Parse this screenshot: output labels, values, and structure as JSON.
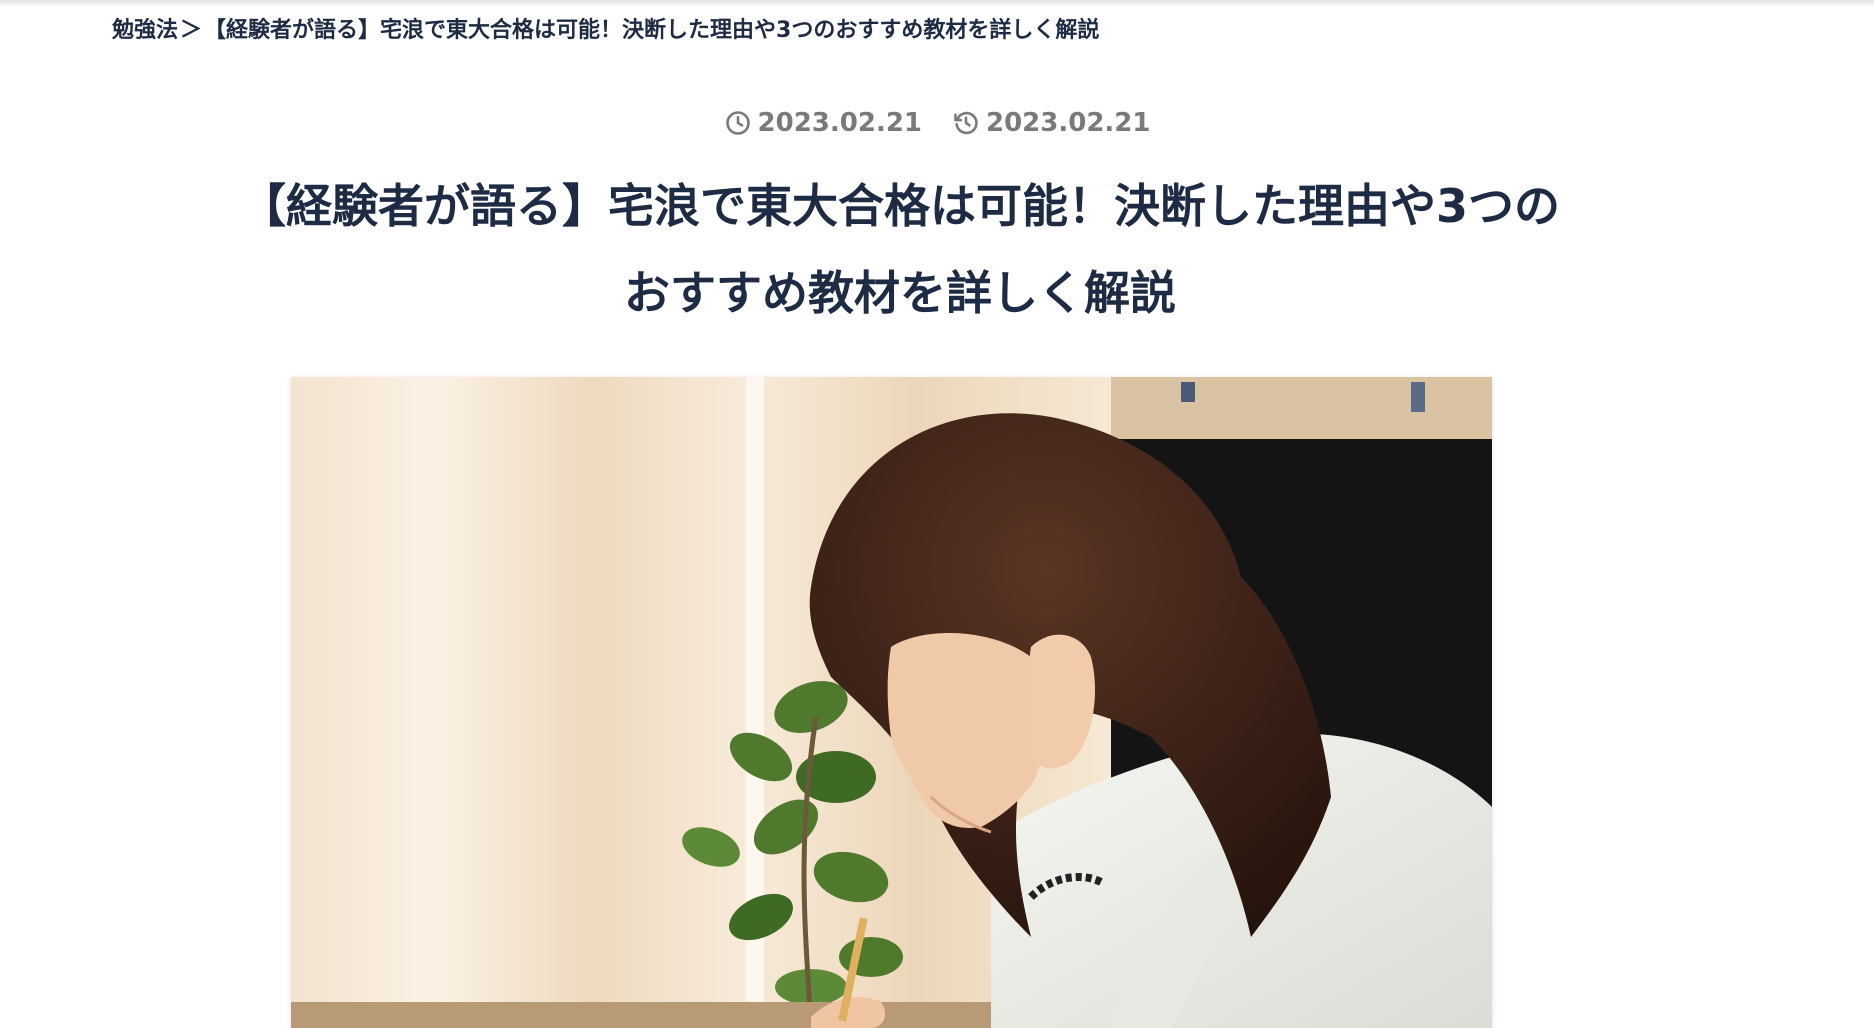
{
  "breadcrumb": {
    "parent": "勉強法",
    "separator": "＞",
    "current": "【経験者が語る】宅浪で東大合格は可能！決断した理由や3つのおすすめ教材を詳しく解説"
  },
  "meta": {
    "published_date": "2023.02.21",
    "updated_date": "2023.02.21",
    "published_icon": "clock-icon",
    "updated_icon": "history-icon"
  },
  "article": {
    "title_line1": "【経験者が語る】宅浪で東大合格は可能！決断した理由や3つの",
    "title_line2": "おすすめ教材を詳しく解説"
  },
  "colors": {
    "text_primary": "#1e2b45",
    "meta_gray": "#7a7a7a"
  }
}
